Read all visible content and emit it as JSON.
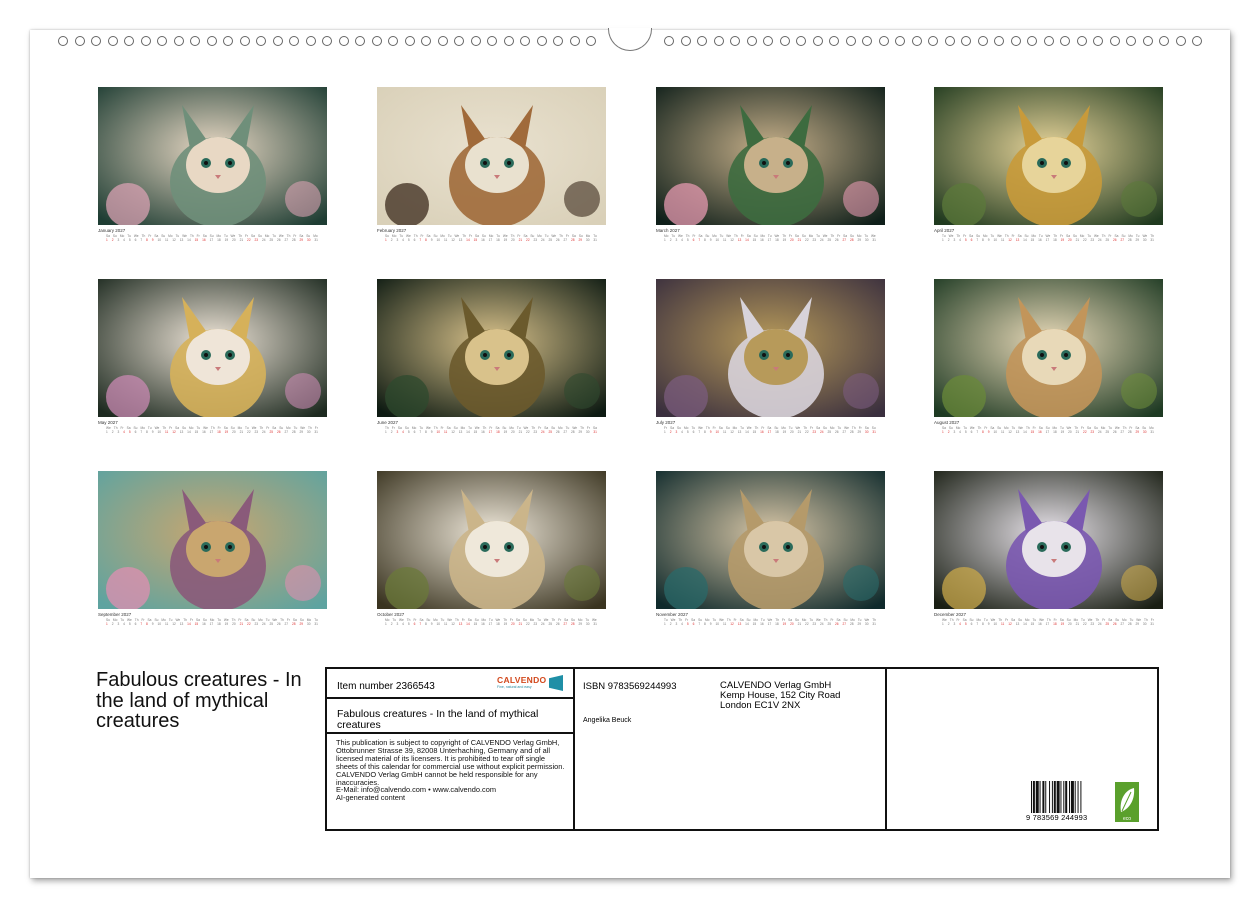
{
  "months": [
    {
      "name": "January",
      "year": "2027"
    },
    {
      "name": "February",
      "year": "2027"
    },
    {
      "name": "March",
      "year": "2027"
    },
    {
      "name": "April",
      "year": "2027"
    },
    {
      "name": "May",
      "year": "2027"
    },
    {
      "name": "June",
      "year": "2027"
    },
    {
      "name": "July",
      "year": "2027"
    },
    {
      "name": "August",
      "year": "2027"
    },
    {
      "name": "September",
      "year": "2027"
    },
    {
      "name": "October",
      "year": "2027"
    },
    {
      "name": "November",
      "year": "2027"
    },
    {
      "name": "December",
      "year": "2027"
    }
  ],
  "title": "Fabulous creatures - In the land of mythical creatures",
  "info": {
    "item_number": "Item number 2366543",
    "brand": "CALVENDO",
    "brand_sub": "Fine, natural and easy",
    "product_title": "Fabulous creatures - In the land of mythical creatures",
    "legal": "This publication is subject to copyright of CALVENDO Verlag GmbH, Ottobrunner Strasse 39, 82008 Unterhaching, Germany and of all licensed material of its licensers. It is prohibited to tear off single sheets of this calendar for commercial use without explicit permission. CALVENDO Verlag GmbH cannot be held responsible for any inaccuracies.",
    "email": "E-Mail: info@calvendo.com • www.calvendo.com",
    "ai_note": "AI-generated content",
    "isbn": "ISBN 9783569244993",
    "publisher_name": "CALVENDO Verlag GmbH",
    "publisher_street": "Kemp House, 152 City Road",
    "publisher_city": "London EC1V 2NX",
    "author": "Angelika Beuck",
    "barcode_digits": "9 783569 244993",
    "eco_label": "eco"
  }
}
